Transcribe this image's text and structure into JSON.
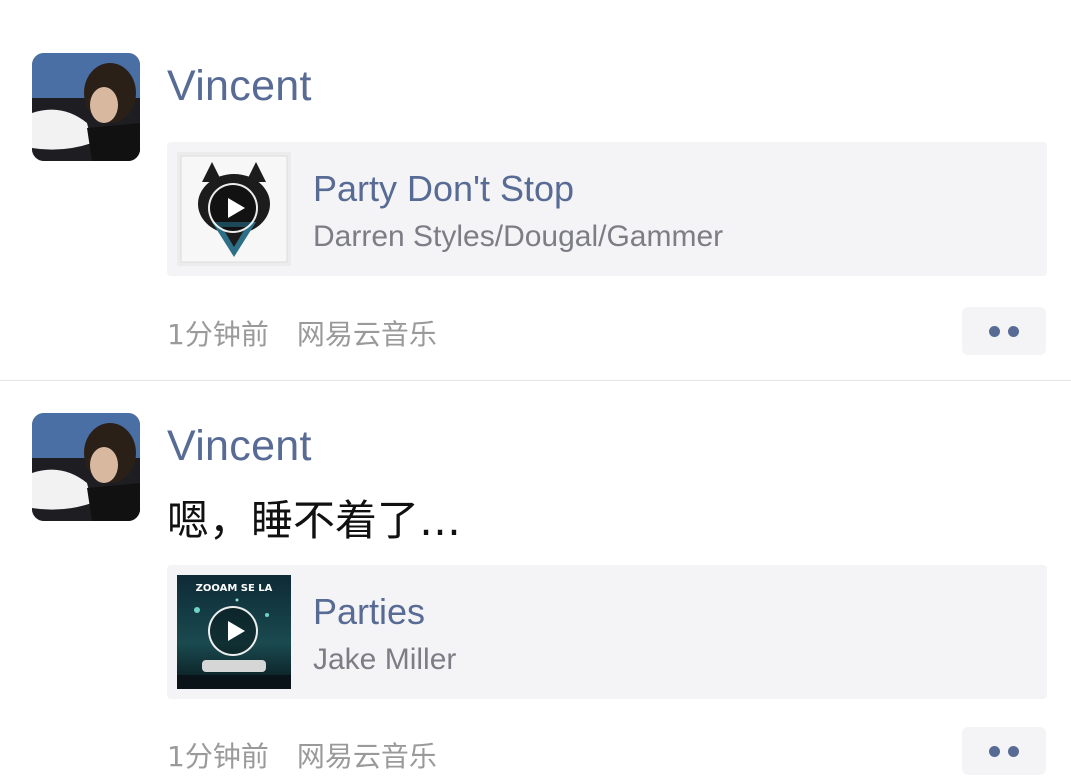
{
  "posts": [
    {
      "author": "Vincent",
      "text": "",
      "song": {
        "title": "Party Don't Stop",
        "artist": "Darren Styles/Dougal/Gammer"
      },
      "time": "1分钟前",
      "source": "网易云音乐"
    },
    {
      "author": "Vincent",
      "text": "嗯，睡不着了…",
      "song": {
        "title": "Parties",
        "artist": "Jake Miller",
        "cover_text": "ZOOAM SE LA"
      },
      "time": "1分钟前",
      "source": "网易云音乐"
    }
  ],
  "icons": {
    "more": "more-dots-icon",
    "play": "play-icon"
  },
  "colors": {
    "link": "#576b95",
    "meta": "#9a9a9a",
    "card_bg": "#f4f4f6"
  }
}
